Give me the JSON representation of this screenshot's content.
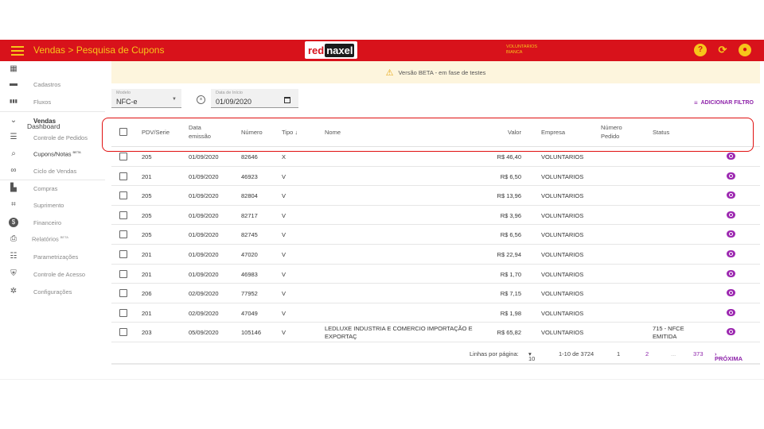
{
  "header": {
    "title": "Vendas > Pesquisa de Cupons",
    "logo_red": "red",
    "logo_dark": "naxel",
    "user_line1": "VOLUNTARIOS",
    "user_line2": "BIANCA",
    "help_icon": "?",
    "refresh_icon": "⟳",
    "account_icon": "👤"
  },
  "sidebar": {
    "items": [
      {
        "label": "Dashboard",
        "icon": "dashboard-icon",
        "glyph": "▦"
      },
      {
        "label": "Cadastros",
        "icon": "folder-icon",
        "glyph": "▬"
      },
      {
        "label": "Fluxos",
        "icon": "columns-icon",
        "glyph": "▮▮▮"
      },
      {
        "label": "Vendas",
        "icon": "chevron-down-icon",
        "glyph": "⌄"
      },
      {
        "label": "Controle de Pedidos",
        "icon": "list-icon",
        "glyph": "☰"
      },
      {
        "label": "Cupons/Notas",
        "badge": "BETA",
        "icon": "search-icon",
        "glyph": "⌕"
      },
      {
        "label": "Ciclo de Vendas",
        "icon": "infinity-icon",
        "glyph": "∞"
      },
      {
        "label": "Compras",
        "icon": "store-icon",
        "glyph": "▙"
      },
      {
        "label": "Suprimento",
        "icon": "crop-icon",
        "glyph": "⌗"
      },
      {
        "label": "Financeiro",
        "icon": "money-icon",
        "glyph": "$"
      },
      {
        "label": "Relatórios",
        "badge": "BETA",
        "icon": "printer-icon",
        "glyph": "⎙"
      },
      {
        "label": "Parametrizações",
        "icon": "sliders-icon",
        "glyph": "☷"
      },
      {
        "label": "Controle de Acesso",
        "icon": "shield-icon",
        "glyph": "⛨"
      },
      {
        "label": "Configurações",
        "icon": "gear-icon",
        "glyph": "✲"
      }
    ]
  },
  "banner": {
    "text": "Versão BETA - em fase de testes",
    "icon": "⚠"
  },
  "filters": {
    "modelo_label": "Modelo",
    "modelo_value": "NFC-e",
    "data_label": "Data de Início",
    "data_value": "01/09/2020",
    "add_filter": "ADICIONAR FILTRO"
  },
  "table": {
    "headers": {
      "pdv": "PDV/Serie",
      "data_l1": "Data",
      "data_l2": "emissão",
      "numero": "Número",
      "tipo": "Tipo ↓",
      "nome": "Nome",
      "valor": "Valor",
      "empresa": "Empresa",
      "pedido_l1": "Número",
      "pedido_l2": "Pedido",
      "status": "Status"
    },
    "rows": [
      {
        "pdv": "205",
        "data": "01/09/2020",
        "numero": "82646",
        "tipo": "X",
        "nome": "",
        "valor": "R$ 46,40",
        "empresa": "VOLUNTARIOS",
        "pedido": "",
        "status": ""
      },
      {
        "pdv": "201",
        "data": "01/09/2020",
        "numero": "46923",
        "tipo": "V",
        "nome": "",
        "valor": "R$ 6,50",
        "empresa": "VOLUNTARIOS",
        "pedido": "",
        "status": ""
      },
      {
        "pdv": "205",
        "data": "01/09/2020",
        "numero": "82804",
        "tipo": "V",
        "nome": "",
        "valor": "R$ 13,96",
        "empresa": "VOLUNTARIOS",
        "pedido": "",
        "status": ""
      },
      {
        "pdv": "205",
        "data": "01/09/2020",
        "numero": "82717",
        "tipo": "V",
        "nome": "",
        "valor": "R$ 3,96",
        "empresa": "VOLUNTARIOS",
        "pedido": "",
        "status": ""
      },
      {
        "pdv": "205",
        "data": "01/09/2020",
        "numero": "82745",
        "tipo": "V",
        "nome": "",
        "valor": "R$ 6,56",
        "empresa": "VOLUNTARIOS",
        "pedido": "",
        "status": ""
      },
      {
        "pdv": "201",
        "data": "01/09/2020",
        "numero": "47020",
        "tipo": "V",
        "nome": "",
        "valor": "R$ 22,94",
        "empresa": "VOLUNTARIOS",
        "pedido": "",
        "status": ""
      },
      {
        "pdv": "201",
        "data": "01/09/2020",
        "numero": "46983",
        "tipo": "V",
        "nome": "",
        "valor": "R$ 1,70",
        "empresa": "VOLUNTARIOS",
        "pedido": "",
        "status": ""
      },
      {
        "pdv": "206",
        "data": "02/09/2020",
        "numero": "77952",
        "tipo": "V",
        "nome": "",
        "valor": "R$ 7,15",
        "empresa": "VOLUNTARIOS",
        "pedido": "",
        "status": ""
      },
      {
        "pdv": "201",
        "data": "02/09/2020",
        "numero": "47049",
        "tipo": "V",
        "nome": "",
        "valor": "R$ 1,98",
        "empresa": "VOLUNTARIOS",
        "pedido": "",
        "status": ""
      },
      {
        "pdv": "203",
        "data": "05/09/2020",
        "numero": "105146",
        "tipo": "V",
        "nome": "LEDLUXE INDUSTRIA E COMERCIO IMPORTAÇÃO E EXPORTAÇ",
        "valor": "R$ 65,82",
        "empresa": "VOLUNTARIOS",
        "pedido": "",
        "status": "715 - NFCE EMITIDA"
      }
    ]
  },
  "pagination": {
    "rows_label": "Linhas por página:",
    "rows_value": "10",
    "range": "1-10 de 3724",
    "page1": "1",
    "page2": "2",
    "ellipsis": "...",
    "last": "373",
    "next": "PRÓXIMA"
  },
  "colors": {
    "topbar": "#d8121b",
    "accent": "#f7c51a",
    "link": "#8e24aa",
    "banner": "#fdf5dd"
  }
}
